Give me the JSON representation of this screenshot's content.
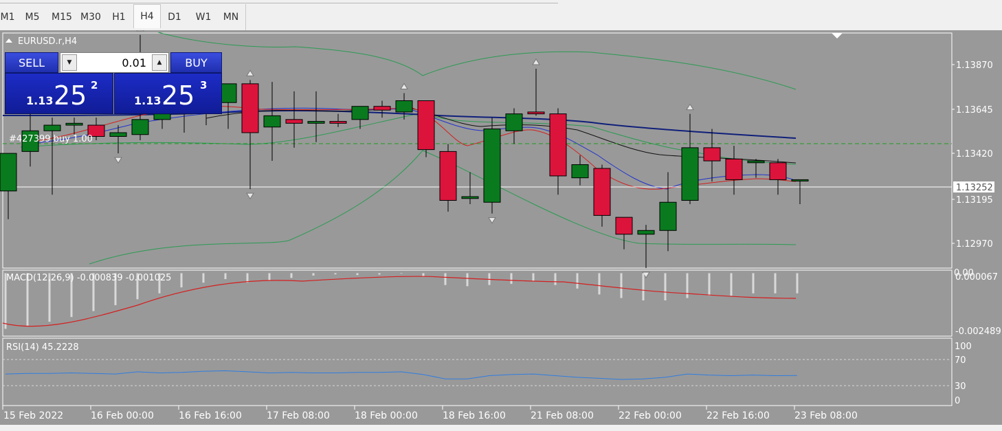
{
  "toolbar": {
    "timeframes": [
      "M1",
      "M5",
      "M15",
      "M30",
      "H1",
      "H4",
      "D1",
      "W1",
      "MN"
    ],
    "active": "H4"
  },
  "chart": {
    "symbol_label": "EURUSD.r,H4",
    "order_label": "#427399 buy 1.00",
    "current_price": "1.13252",
    "price_ticks": [
      "1.13870",
      "1.13645",
      "1.13420",
      "1.13195",
      "1.12970"
    ],
    "time_ticks": [
      "15 Feb 2022",
      "16 Feb 00:00",
      "16 Feb 16:00",
      "17 Feb 08:00",
      "18 Feb 00:00",
      "18 Feb 16:00",
      "21 Feb 08:00",
      "22 Feb 00:00",
      "22 Feb 16:00",
      "23 Feb 08:00"
    ]
  },
  "trade_panel": {
    "sell_label": "SELL",
    "buy_label": "BUY",
    "lot_value": "0.01",
    "sell_price_small": "1.13",
    "sell_price_big": "25",
    "sell_price_sup": "2",
    "buy_price_small": "1.13",
    "buy_price_big": "25",
    "buy_price_sup": "3"
  },
  "macd": {
    "label": "MACD(12,26,9) -0.000839 -0.001025",
    "ticks": [
      "0.00",
      "0.000067",
      "-0.002489"
    ]
  },
  "rsi": {
    "label": "RSI(14) 45.2228",
    "ticks": [
      "100",
      "70",
      "30",
      "0"
    ]
  },
  "chart_data": {
    "type": "candlestick",
    "ylim": [
      1.1284,
      1.1409
    ],
    "candles": [
      {
        "o": 1.1325,
        "h": 1.1345,
        "l": 1.131,
        "c": 1.1345
      },
      {
        "o": 1.1346,
        "h": 1.1366,
        "l": 1.1338,
        "c": 1.1357
      },
      {
        "o": 1.1357,
        "h": 1.1364,
        "l": 1.1323,
        "c": 1.136
      },
      {
        "o": 1.136,
        "h": 1.1364,
        "l": 1.1355,
        "c": 1.1361
      },
      {
        "o": 1.136,
        "h": 1.1364,
        "l": 1.1352,
        "c": 1.1354
      },
      {
        "o": 1.1354,
        "h": 1.136,
        "l": 1.1345,
        "c": 1.1356
      },
      {
        "o": 1.1355,
        "h": 1.1408,
        "l": 1.1352,
        "c": 1.1363
      },
      {
        "o": 1.1363,
        "h": 1.1372,
        "l": 1.1358,
        "c": 1.1366
      },
      {
        "o": 1.1366,
        "h": 1.1393,
        "l": 1.1356,
        "c": 1.1369
      },
      {
        "o": 1.1369,
        "h": 1.1374,
        "l": 1.136,
        "c": 1.1372
      },
      {
        "o": 1.1372,
        "h": 1.138,
        "l": 1.1358,
        "c": 1.1382
      },
      {
        "o": 1.1382,
        "h": 1.1384,
        "l": 1.1326,
        "c": 1.1356
      },
      {
        "o": 1.1359,
        "h": 1.1383,
        "l": 1.1341,
        "c": 1.1365
      },
      {
        "o": 1.1363,
        "h": 1.1378,
        "l": 1.1348,
        "c": 1.1361
      },
      {
        "o": 1.1361,
        "h": 1.1378,
        "l": 1.1351,
        "c": 1.1362
      },
      {
        "o": 1.1362,
        "h": 1.1366,
        "l": 1.1359,
        "c": 1.1361
      },
      {
        "o": 1.1363,
        "h": 1.1368,
        "l": 1.1358,
        "c": 1.137
      },
      {
        "o": 1.137,
        "h": 1.1373,
        "l": 1.1364,
        "c": 1.1368
      },
      {
        "o": 1.1367,
        "h": 1.1377,
        "l": 1.1363,
        "c": 1.1373
      },
      {
        "o": 1.1373,
        "h": 1.1372,
        "l": 1.1343,
        "c": 1.1347
      },
      {
        "o": 1.1346,
        "h": 1.135,
        "l": 1.1314,
        "c": 1.132
      },
      {
        "o": 1.1321,
        "h": 1.1335,
        "l": 1.1318,
        "c": 1.1322
      },
      {
        "o": 1.1319,
        "h": 1.1364,
        "l": 1.1313,
        "c": 1.1358
      },
      {
        "o": 1.1357,
        "h": 1.1369,
        "l": 1.135,
        "c": 1.1366
      },
      {
        "o": 1.1367,
        "h": 1.139,
        "l": 1.1365,
        "c": 1.1366
      },
      {
        "o": 1.1366,
        "h": 1.1369,
        "l": 1.1323,
        "c": 1.1333
      },
      {
        "o": 1.1332,
        "h": 1.1344,
        "l": 1.1328,
        "c": 1.1339
      },
      {
        "o": 1.1337,
        "h": 1.1339,
        "l": 1.1306,
        "c": 1.1312
      },
      {
        "o": 1.1311,
        "h": 1.1302,
        "l": 1.1294,
        "c": 1.1302
      },
      {
        "o": 1.1302,
        "h": 1.1307,
        "l": 1.1284,
        "c": 1.1304
      },
      {
        "o": 1.1304,
        "h": 1.1335,
        "l": 1.1293,
        "c": 1.1319
      },
      {
        "o": 1.132,
        "h": 1.1366,
        "l": 1.1318,
        "c": 1.1348
      },
      {
        "o": 1.1348,
        "h": 1.1358,
        "l": 1.133,
        "c": 1.1341
      },
      {
        "o": 1.1342,
        "h": 1.1349,
        "l": 1.1323,
        "c": 1.1331
      },
      {
        "o": 1.134,
        "h": 1.1342,
        "l": 1.1332,
        "c": 1.1341
      },
      {
        "o": 1.134,
        "h": 1.1342,
        "l": 1.1323,
        "c": 1.1331
      },
      {
        "o": 1.1331,
        "h": 1.1331,
        "l": 1.1318,
        "c": 1.1331
      }
    ],
    "macd_histogram": [
      -0.00235,
      -0.00225,
      -0.00205,
      -0.00185,
      -0.0016,
      -0.00135,
      -0.0011,
      -0.00085,
      -0.0006,
      -0.0004,
      -0.00025,
      -0.0004,
      -0.0003,
      -0.0002,
      -0.0001,
      -5e-05,
      -8e-05,
      -6e-05,
      -2e-05,
      -0.00015,
      -0.0005,
      -0.00055,
      -0.0005,
      -0.00045,
      -0.00035,
      -0.0005,
      -0.00065,
      -0.0009,
      -0.00105,
      -0.00115,
      -0.00115,
      -0.00105,
      -0.00095,
      -0.00095,
      -0.00085,
      -0.00085,
      -0.00085
    ],
    "rsi": [
      48,
      49,
      49,
      50,
      49,
      48,
      52,
      50,
      51,
      53,
      54,
      52,
      50,
      51,
      50,
      50,
      51,
      51,
      52,
      47,
      39,
      39,
      45,
      47,
      48,
      45,
      42,
      40,
      38,
      39,
      42,
      48,
      46,
      45,
      46,
      45,
      45.2
    ]
  }
}
